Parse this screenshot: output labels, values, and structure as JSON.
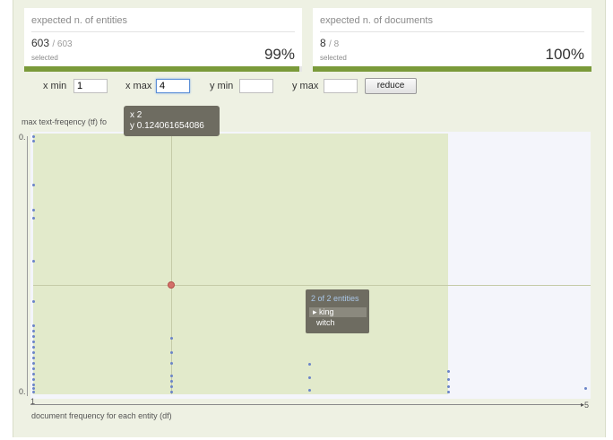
{
  "cards": {
    "entities": {
      "title": "expected n. of entities",
      "count": "603",
      "total": "/ 603",
      "sub": "selected",
      "percent": "99%",
      "progress": 0.99
    },
    "documents": {
      "title": "expected n. of documents",
      "count": "8",
      "total": "/ 8",
      "sub": "selected",
      "percent": "100%",
      "progress": 1.0
    }
  },
  "filters": {
    "xmin_label": "x min",
    "xmin_value": "1",
    "xmax_label": "x max",
    "xmax_value": "4",
    "ymin_label": "y min",
    "ymin_value": "",
    "ymax_label": "y max",
    "ymax_value": "",
    "reduce_label": "reduce"
  },
  "plot": {
    "ylabel": "max text-freqency (tf) fo",
    "y_tick_top": "0.",
    "y_tick_bottom": "0.",
    "x_tick_start": "1",
    "x_tick_end": "5",
    "xlabel": "document frequency for each entity (df)",
    "tooltip_x": "x 2",
    "tooltip_y": "y 0.124061654086",
    "entity_tooltip": {
      "header": "2 of 2 entities",
      "items": [
        "king",
        "witch"
      ]
    },
    "colors": {
      "selection": "#e2eacb",
      "points": "#6b84c8",
      "hover": "#d3706a",
      "accent": "#7a9a3a"
    }
  }
}
